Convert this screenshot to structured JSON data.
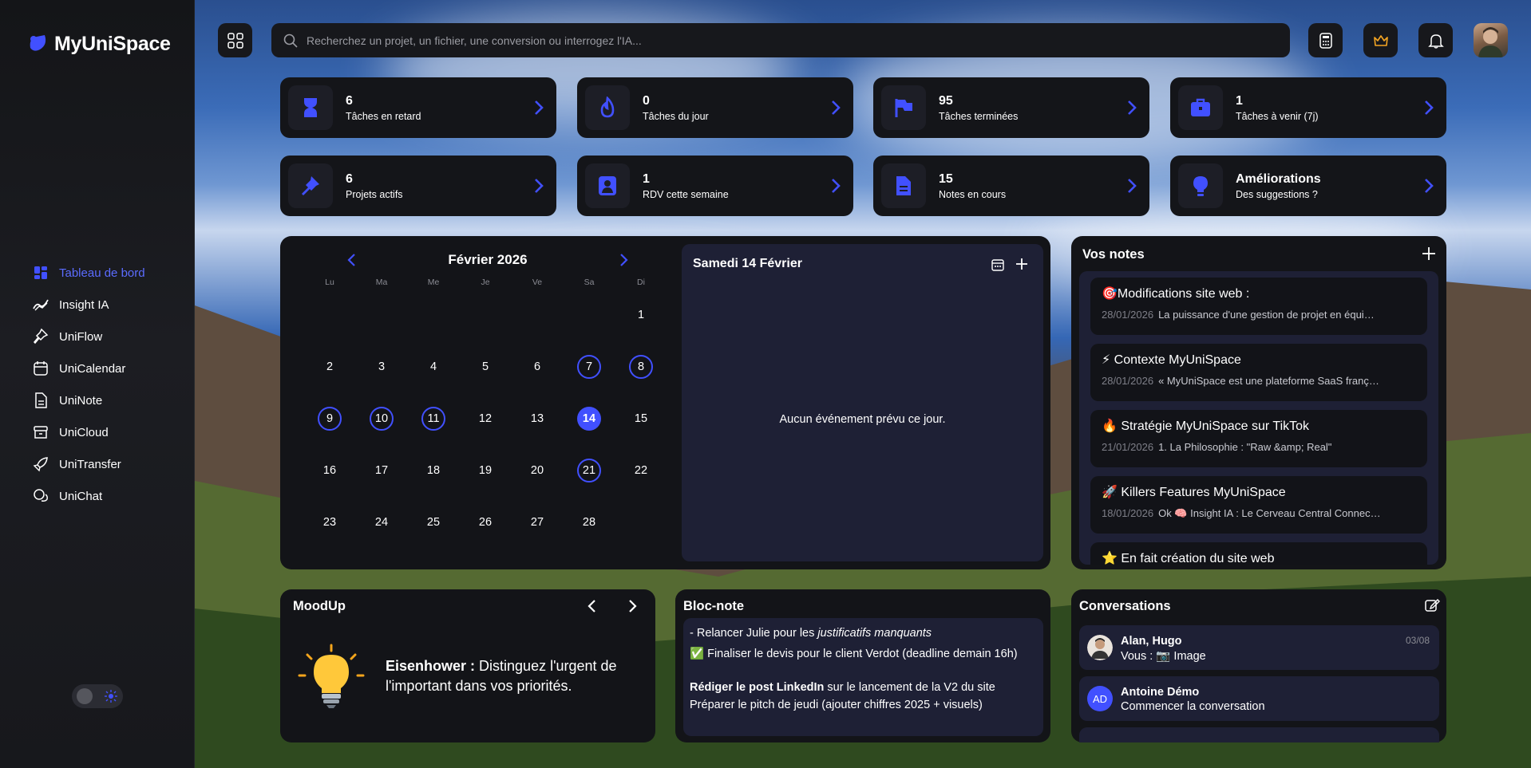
{
  "app": {
    "name": "MyUniSpace"
  },
  "search": {
    "placeholder": "Recherchez un projet, un fichier, une conversion ou interrogez l'IA..."
  },
  "colors": {
    "accent": "#4150ff",
    "accent_text": "#5b6cff",
    "panel": "#131418",
    "inner": "#1e2035"
  },
  "sidebar": {
    "items": [
      {
        "label": "Tableau de bord",
        "icon": "dashboard-icon",
        "active": true
      },
      {
        "label": "Insight IA",
        "icon": "insight-icon"
      },
      {
        "label": "UniFlow",
        "icon": "pin-icon"
      },
      {
        "label": "UniCalendar",
        "icon": "calendar-icon"
      },
      {
        "label": "UniNote",
        "icon": "note-icon"
      },
      {
        "label": "UniCloud",
        "icon": "archive-icon"
      },
      {
        "label": "UniTransfer",
        "icon": "rocket-icon"
      },
      {
        "label": "UniChat",
        "icon": "chat-icon"
      }
    ]
  },
  "stats": [
    {
      "value": "6",
      "label": "Tâches en retard",
      "icon": "hourglass-icon"
    },
    {
      "value": "0",
      "label": "Tâches du jour",
      "icon": "fire-icon"
    },
    {
      "value": "95",
      "label": "Tâches terminées",
      "icon": "flag-icon"
    },
    {
      "value": "1",
      "label": "Tâches à venir (7j)",
      "icon": "briefcase-icon"
    },
    {
      "value": "6",
      "label": "Projets actifs",
      "icon": "pushpin-icon"
    },
    {
      "value": "1",
      "label": "RDV cette semaine",
      "icon": "contact-icon"
    },
    {
      "value": "15",
      "label": "Notes en cours",
      "icon": "document-icon"
    },
    {
      "value": "Améliorations",
      "label": "Des suggestions ?",
      "icon": "lightbulb-icon"
    }
  ],
  "calendar": {
    "month": "Février 2026",
    "weekdays": [
      "Lu",
      "Ma",
      "Me",
      "Je",
      "Ve",
      "Sa",
      "Di"
    ],
    "days": [
      {
        "d": "1",
        "row": 0,
        "col": 6
      },
      {
        "d": "2",
        "row": 1,
        "col": 0
      },
      {
        "d": "3",
        "row": 1,
        "col": 1
      },
      {
        "d": "4",
        "row": 1,
        "col": 2
      },
      {
        "d": "5",
        "row": 1,
        "col": 3
      },
      {
        "d": "6",
        "row": 1,
        "col": 4
      },
      {
        "d": "7",
        "row": 1,
        "col": 5,
        "ring": true
      },
      {
        "d": "8",
        "row": 1,
        "col": 6,
        "ring": true
      },
      {
        "d": "9",
        "row": 2,
        "col": 0,
        "ring": true
      },
      {
        "d": "10",
        "row": 2,
        "col": 1,
        "ring": true
      },
      {
        "d": "11",
        "row": 2,
        "col": 2,
        "ring": true
      },
      {
        "d": "12",
        "row": 2,
        "col": 3
      },
      {
        "d": "13",
        "row": 2,
        "col": 4
      },
      {
        "d": "14",
        "row": 2,
        "col": 5,
        "selected": true
      },
      {
        "d": "15",
        "row": 2,
        "col": 6
      },
      {
        "d": "16",
        "row": 3,
        "col": 0
      },
      {
        "d": "17",
        "row": 3,
        "col": 1
      },
      {
        "d": "18",
        "row": 3,
        "col": 2
      },
      {
        "d": "19",
        "row": 3,
        "col": 3
      },
      {
        "d": "20",
        "row": 3,
        "col": 4
      },
      {
        "d": "21",
        "row": 3,
        "col": 5,
        "ring": true
      },
      {
        "d": "22",
        "row": 3,
        "col": 6
      },
      {
        "d": "23",
        "row": 4,
        "col": 0
      },
      {
        "d": "24",
        "row": 4,
        "col": 1
      },
      {
        "d": "25",
        "row": 4,
        "col": 2
      },
      {
        "d": "26",
        "row": 4,
        "col": 3
      },
      {
        "d": "27",
        "row": 4,
        "col": 4
      },
      {
        "d": "28",
        "row": 4,
        "col": 5
      }
    ]
  },
  "agenda": {
    "title": "Samedi 14 Février",
    "empty": "Aucun événement prévu ce jour."
  },
  "notes": {
    "title": "Vos notes",
    "items": [
      {
        "title": "🎯Modifications site web :",
        "date": "28/01/2026",
        "excerpt": "La puissance d'une gestion de projet en équi…"
      },
      {
        "title": "⚡ Contexte MyUniSpace",
        "date": "28/01/2026",
        "excerpt": "« MyUniSpace est une plateforme SaaS franç…"
      },
      {
        "title": "🔥 Stratégie MyUniSpace sur TikTok",
        "date": "21/01/2026",
        "excerpt": "1. La Philosophie : \"Raw &amp; Real\""
      },
      {
        "title": "🚀 Killers Features MyUniSpace",
        "date": "18/01/2026",
        "excerpt": "Ok 🧠 Insight IA : Le Cerveau Central Connec…"
      },
      {
        "title": "⭐ En fait création du site web",
        "date": "",
        "excerpt": ""
      }
    ]
  },
  "mood": {
    "title": "MoodUp",
    "term": "Eisenhower :",
    "text": " Distinguez l'urgent de l'important dans vos priorités."
  },
  "bloc": {
    "title": "Bloc-note",
    "line1_prefix": "- Relancer Julie pour les ",
    "line1_em": "justificatifs manquants",
    "line2": "✅ Finaliser le devis pour le client Verdot (deadline demain 16h)",
    "line3_strong": "Rédiger le post LinkedIn",
    "line3_rest": " sur le lancement de la V2 du site Préparer le pitch de jeudi (ajouter chiffres 2025 + visuels)"
  },
  "conversations": {
    "title": "Conversations",
    "items": [
      {
        "name": "Alan, Hugo",
        "message": "Vous : 📷 Image",
        "date": "03/08"
      },
      {
        "name": "Antoine Démo",
        "message": "Commencer la conversation",
        "initials": "AD"
      }
    ]
  }
}
